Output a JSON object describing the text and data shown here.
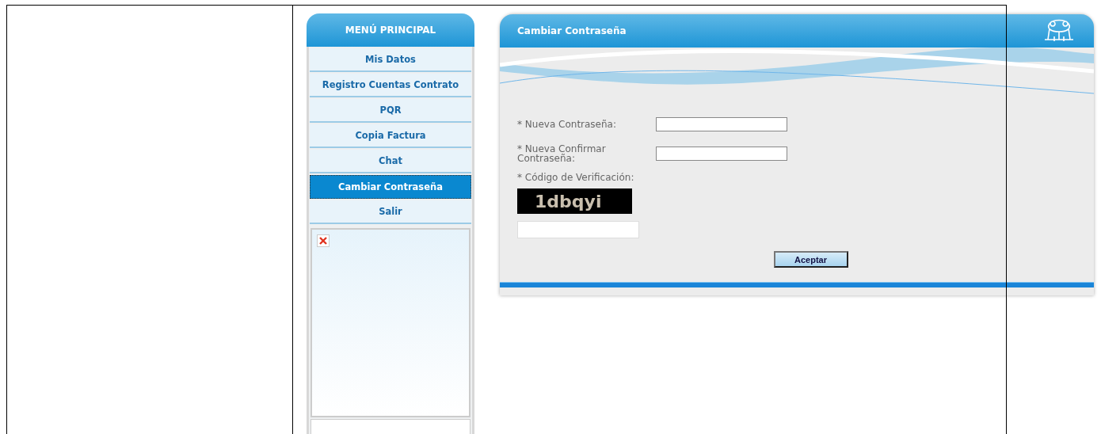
{
  "menu": {
    "title": "MENÚ PRINCIPAL",
    "items": [
      {
        "label": "Mis Datos",
        "selected": false
      },
      {
        "label": "Registro Cuentas Contrato",
        "selected": false
      },
      {
        "label": "PQR",
        "selected": false
      },
      {
        "label": "Copia Factura",
        "selected": false
      },
      {
        "label": "Chat",
        "selected": false
      },
      {
        "label": "Cambiar Contraseña",
        "selected": true
      },
      {
        "label": "Salir",
        "selected": false
      }
    ]
  },
  "panel": {
    "title": "Cambiar Contraseña",
    "fields": [
      {
        "kind": "inline",
        "label": "* Nueva Contraseña:"
      },
      {
        "kind": "inline",
        "label": "* Nueva Confirmar Contraseña:"
      },
      {
        "kind": "captcha",
        "label": "* Código de Verificación:",
        "captcha": "1dbqyi"
      }
    ],
    "button": "Aceptar"
  }
}
